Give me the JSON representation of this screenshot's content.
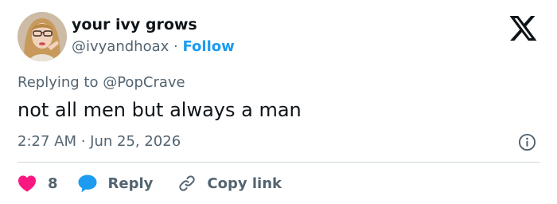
{
  "author": {
    "display_name": "your ivy grows",
    "handle": "@ivyandhoax",
    "separator": "·",
    "follow_label": "Follow"
  },
  "reply_context": {
    "prefix": "Replying to",
    "mention": "@PopCrave"
  },
  "tweet": {
    "text": "not all men but always a man",
    "timestamp": "2:27 AM · Jun 25, 2026"
  },
  "actions": {
    "like_count": "8",
    "reply_label": "Reply",
    "copy_link_label": "Copy link"
  },
  "colors": {
    "link": "#1d9bf0",
    "like": "#f91880",
    "secondary_text": "#536471",
    "primary_text": "#0f1419"
  },
  "icons": [
    "x-logo-icon",
    "info-icon",
    "heart-icon",
    "speech-bubble-icon",
    "link-icon"
  ]
}
